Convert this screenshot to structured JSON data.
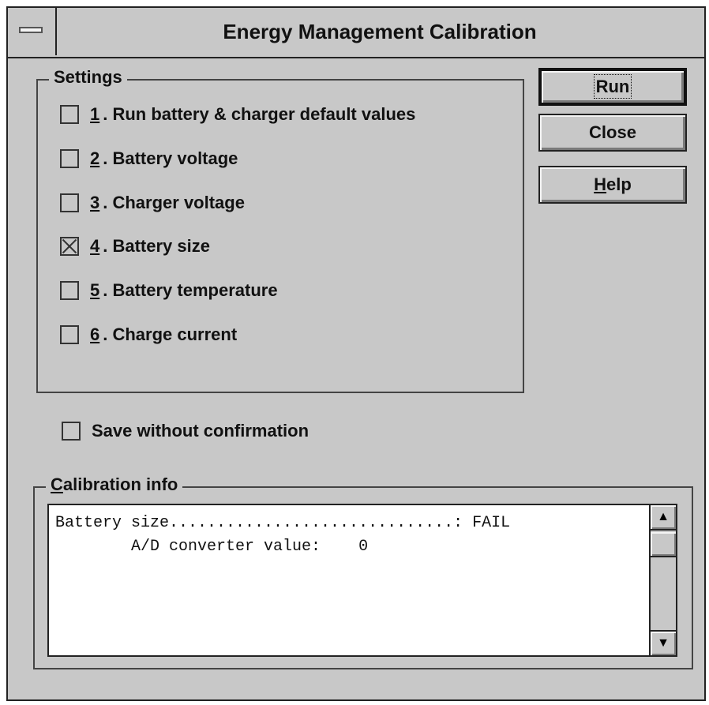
{
  "window": {
    "title": "Energy Management Calibration",
    "system_menu_icon": "system-menu-icon"
  },
  "settings": {
    "group_label": "Settings",
    "items": [
      {
        "num": "1",
        "label": ". Run battery & charger default values",
        "checked": false
      },
      {
        "num": "2",
        "label": ". Battery voltage",
        "checked": false
      },
      {
        "num": "3",
        "label": ". Charger voltage",
        "checked": false
      },
      {
        "num": "4",
        "label": ". Battery size",
        "checked": true
      },
      {
        "num": "5",
        "label": ". Battery temperature",
        "checked": false
      },
      {
        "num": "6",
        "label": ". Charge current",
        "checked": false
      }
    ]
  },
  "save_without_confirmation": {
    "label": "Save without confirmation",
    "checked": false
  },
  "buttons": {
    "run": "Run",
    "close": "Close",
    "help_mnemonic": "H",
    "help_rest": "elp"
  },
  "calibration_info": {
    "label_mnemonic": "C",
    "label_rest": "alibration info",
    "lines": [
      "Battery size..............................: FAIL",
      "        A/D converter value:    0"
    ]
  },
  "scrollbar": {
    "up_icon": "scroll-up-arrow-icon",
    "down_icon": "scroll-down-arrow-icon",
    "up_glyph": "▲",
    "down_glyph": "▼"
  }
}
